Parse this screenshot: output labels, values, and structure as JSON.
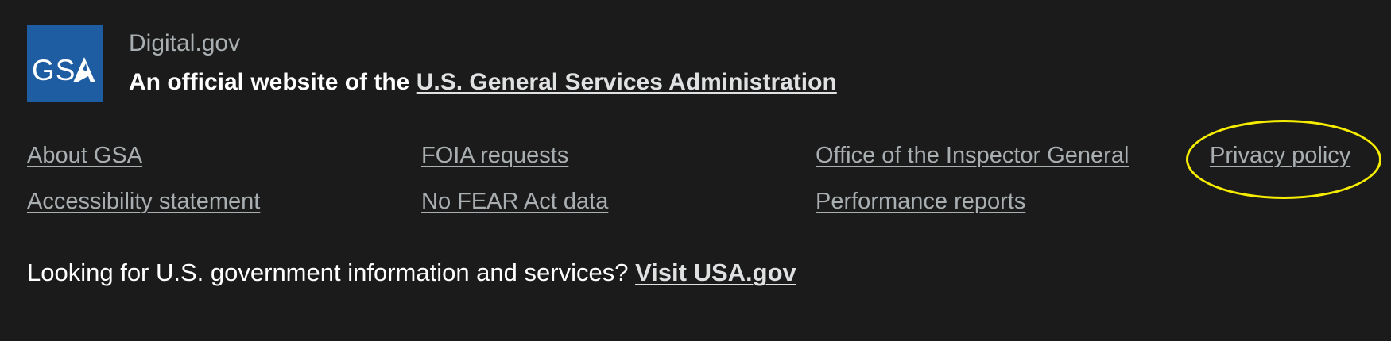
{
  "identity": {
    "logo_text": "GSA",
    "site_name": "Digital.gov",
    "official_prefix": "An official website of the ",
    "agency_link": "U.S. General Services Administration"
  },
  "footer_links": {
    "row1": [
      "About GSA",
      "FOIA requests",
      "Office of the Inspector General",
      "Privacy policy"
    ],
    "row2": [
      "Accessibility statement",
      "No FEAR Act data",
      "Performance reports"
    ]
  },
  "usagov": {
    "prompt": "Looking for U.S. government information and services? ",
    "link": "Visit USA.gov"
  },
  "colors": {
    "background": "#1b1b1b",
    "logo_blue": "#1e5da2",
    "link": "#a9aeb1",
    "highlight": "#f5ec00"
  }
}
